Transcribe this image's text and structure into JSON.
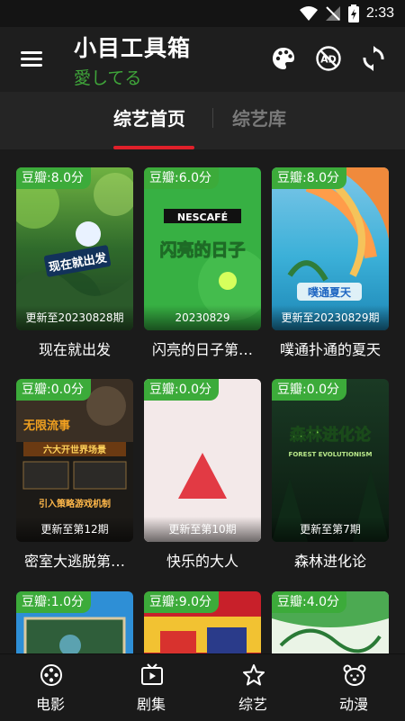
{
  "status_bar": {
    "time": "2:33"
  },
  "app_bar": {
    "title": "小目工具箱",
    "subtitle": "愛してる",
    "icons": [
      "menu-icon",
      "palette-icon",
      "ad-block-icon",
      "refresh-icon"
    ]
  },
  "tabs": [
    {
      "label": "综艺首页",
      "active": true
    },
    {
      "label": "综艺库",
      "active": false
    }
  ],
  "colors": {
    "accent": "#e0202a",
    "rating_bg": "#3cab3a",
    "subtitle": "#3fa53a"
  },
  "cards": [
    {
      "rating": "豆瓣:8.0分",
      "episode": "更新至20230828期",
      "title": "现在就出发"
    },
    {
      "rating": "豆瓣:6.0分",
      "episode": "20230829",
      "title": "闪亮的日子第…"
    },
    {
      "rating": "豆瓣:8.0分",
      "episode": "更新至20230829期",
      "title": "噗通扑通的夏天"
    },
    {
      "rating": "豆瓣:0.0分",
      "episode": "更新至第12期",
      "title": "密室大逃脱第…"
    },
    {
      "rating": "豆瓣:0.0分",
      "episode": "更新至第10期",
      "title": "快乐的大人"
    },
    {
      "rating": "豆瓣:0.0分",
      "episode": "更新至第7期",
      "title": "森林进化论"
    },
    {
      "rating": "豆瓣:1.0分",
      "episode": "",
      "title": ""
    },
    {
      "rating": "豆瓣:9.0分",
      "episode": "",
      "title": ""
    },
    {
      "rating": "豆瓣:4.0分",
      "episode": "",
      "title": ""
    }
  ],
  "poster_text": {
    "c1": "现在就出发",
    "c2_brand": "NESCAFÉ",
    "c2_title": "闪亮的日子",
    "c3": "噗通夏天",
    "c4_a": "无限流事",
    "c4_b": "六大开世界场景",
    "c4_c": "引入策略游戏机制",
    "c6_title": "森林进化论",
    "c6_sub": "FOREST EVOLUTIONISM"
  },
  "bottom_nav": [
    {
      "label": "电影",
      "icon": "film-reel-icon"
    },
    {
      "label": "剧集",
      "icon": "tv-icon"
    },
    {
      "label": "综艺",
      "icon": "star-icon"
    },
    {
      "label": "动漫",
      "icon": "bear-icon"
    }
  ]
}
